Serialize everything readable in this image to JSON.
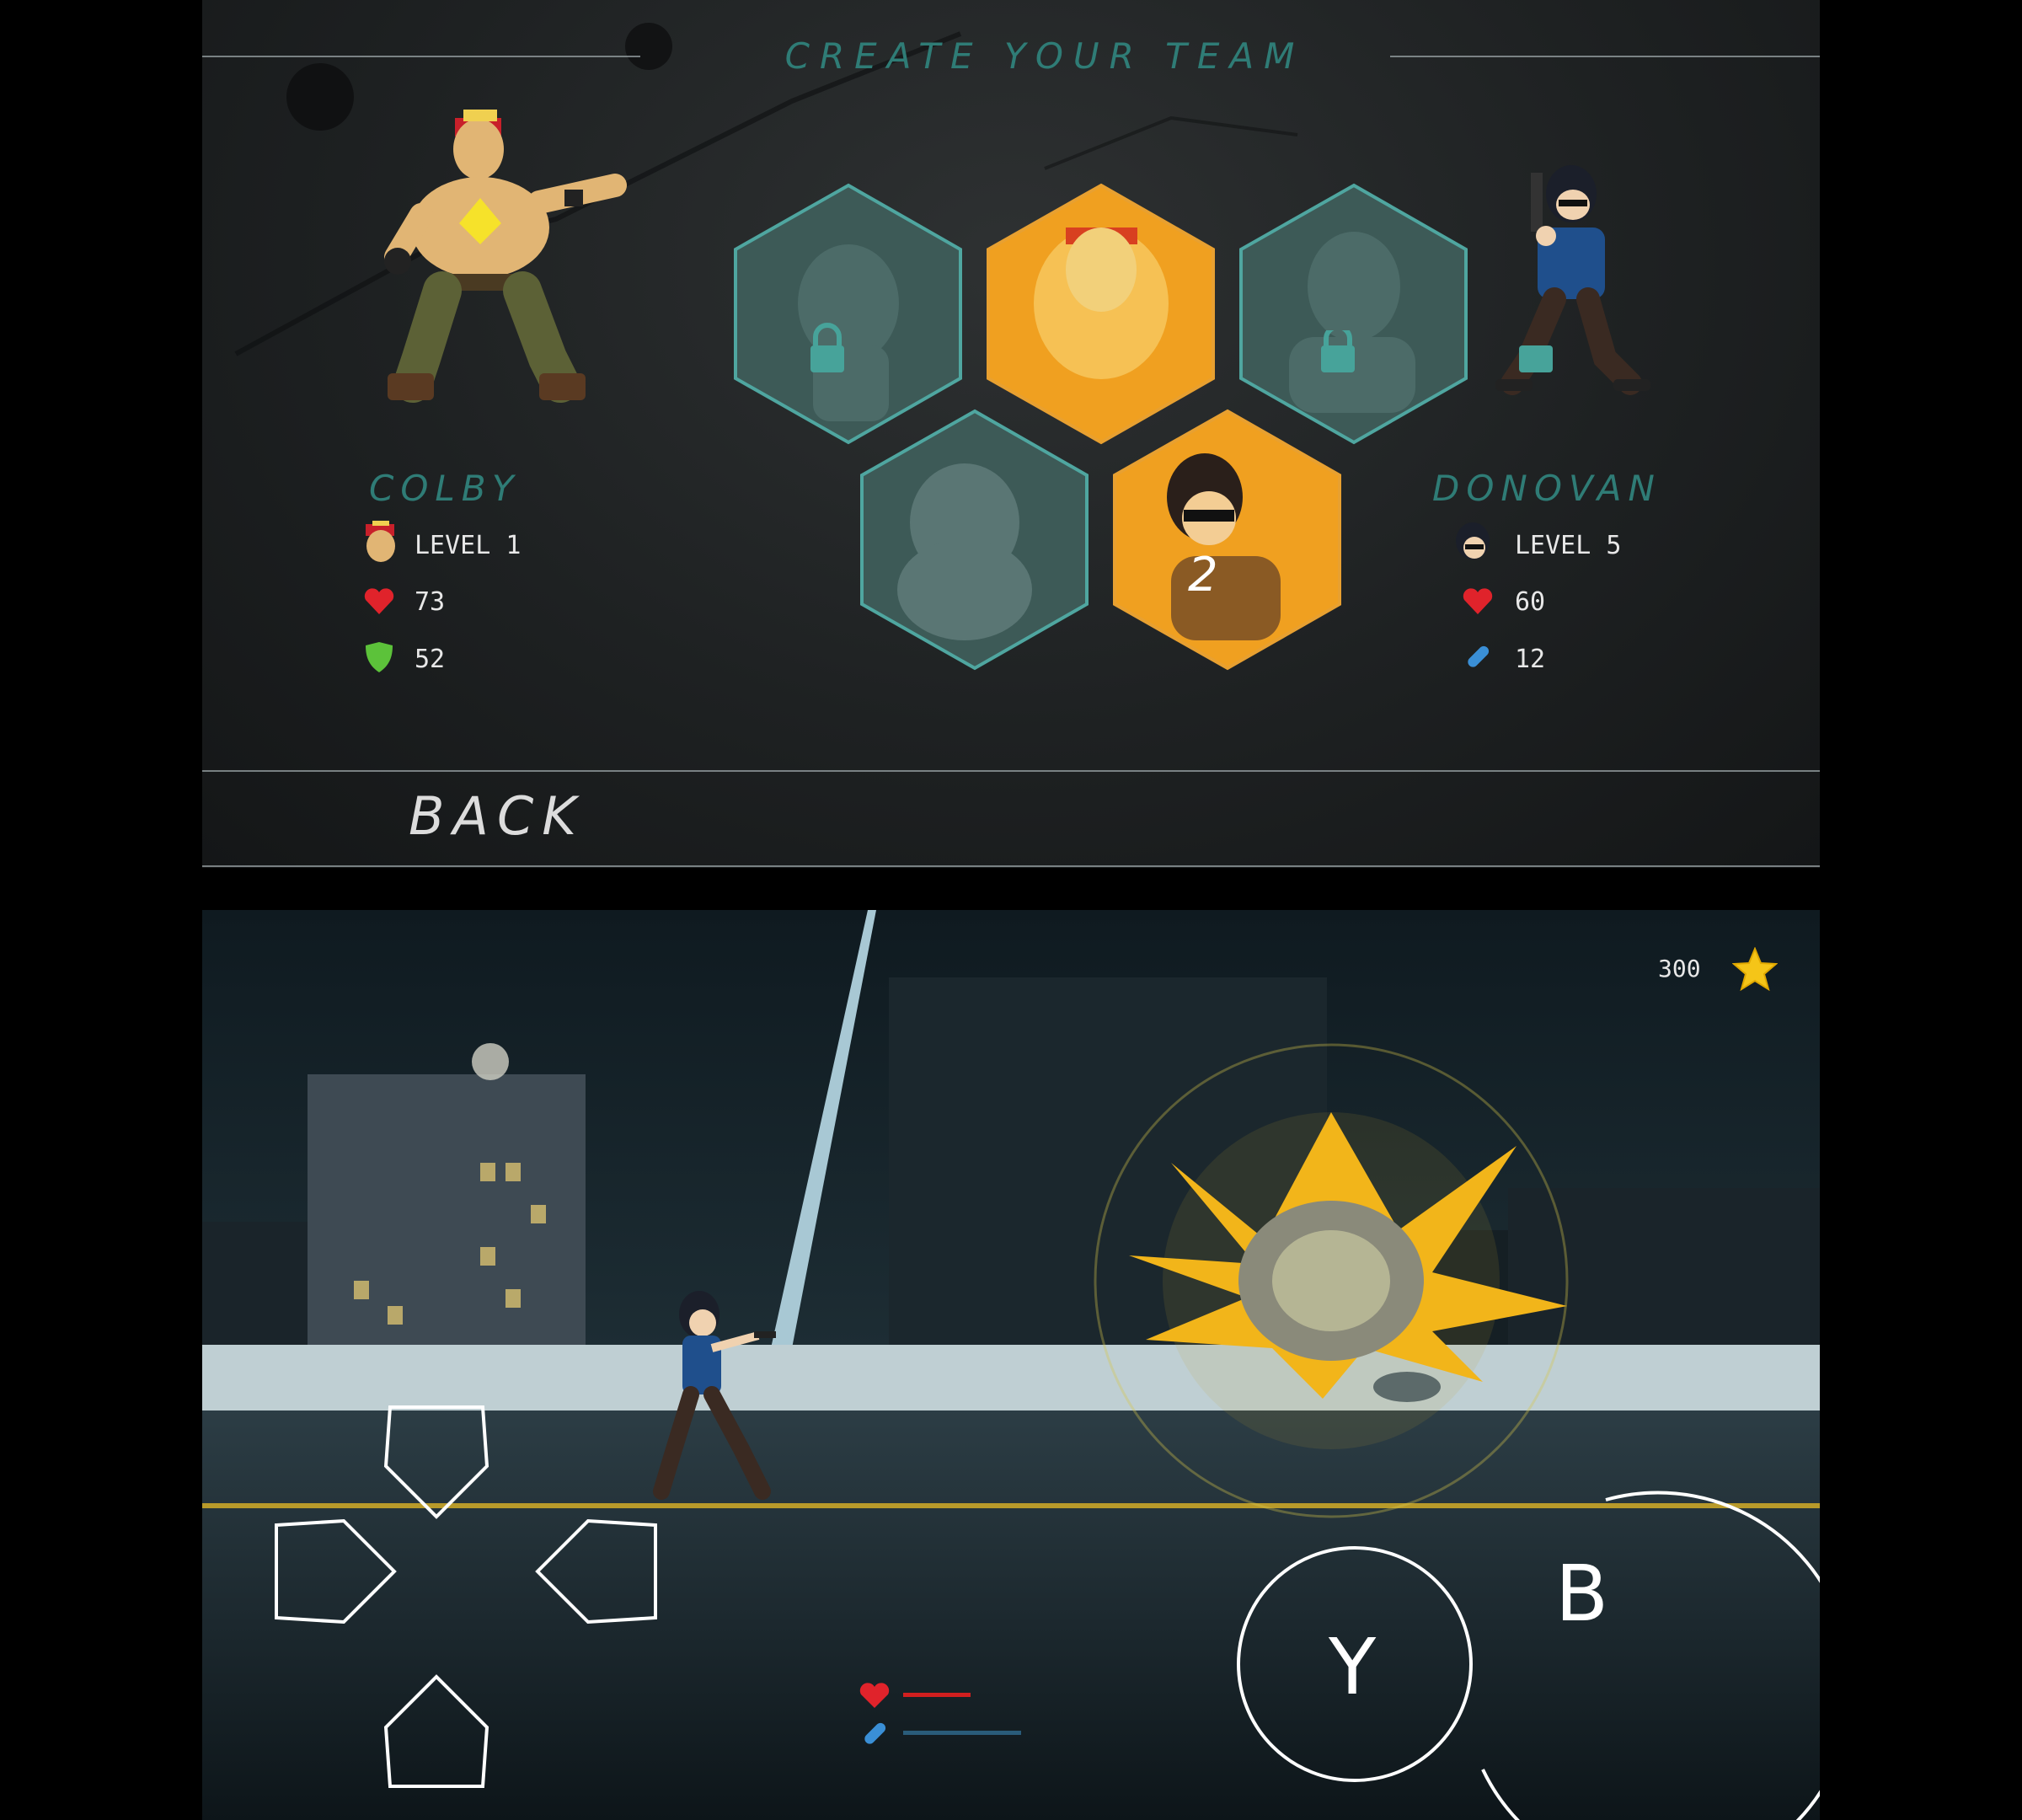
{
  "team_screen": {
    "title": "CREATE YOUR TEAM",
    "back_label": "BACK",
    "left_character": {
      "name": "COLBY",
      "level": "LEVEL 1",
      "health": "73",
      "armor": "52"
    },
    "right_character": {
      "name": "DONOVAN",
      "level": "LEVEL 5",
      "health": "60",
      "ammo": "12"
    },
    "slots": [
      {
        "id": "slot-1",
        "state": "locked",
        "label": ""
      },
      {
        "id": "slot-2",
        "state": "selected",
        "label": ""
      },
      {
        "id": "slot-3",
        "state": "locked",
        "label": ""
      },
      {
        "id": "slot-4",
        "state": "locked",
        "label": ""
      },
      {
        "id": "slot-5",
        "state": "selected",
        "label": "2"
      }
    ],
    "colors": {
      "teal": "#2f7c76",
      "gold": "#f0a020",
      "locked_fill": "#3d5a57",
      "heart": "#e0232b",
      "shield": "#5cc23a",
      "bullet": "#3a8fd6"
    }
  },
  "gameplay": {
    "score": "300",
    "controls": {
      "y_label": "Y",
      "b_label": "B"
    },
    "health_fraction": 0.5,
    "ammo_fraction": 0.9,
    "colors": {
      "health_bar": "#d11f1f",
      "ammo_bar": "#2a5c7a",
      "star": "#f5c518"
    }
  }
}
